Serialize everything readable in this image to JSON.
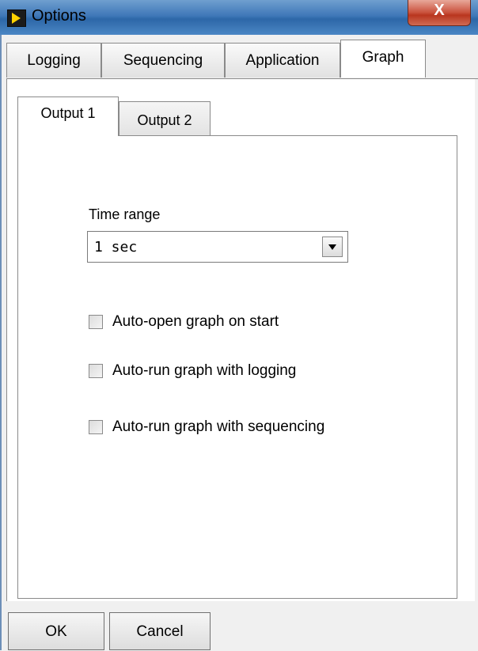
{
  "window": {
    "title": "Options",
    "close_label": "X"
  },
  "top_tabs": [
    {
      "label": "Logging"
    },
    {
      "label": "Sequencing"
    },
    {
      "label": "Application"
    },
    {
      "label": "Graph"
    }
  ],
  "inner_tabs": [
    {
      "label": "Output 1"
    },
    {
      "label": "Output 2"
    }
  ],
  "graph": {
    "time_range_label": "Time range",
    "time_range_value": "1 sec",
    "checkboxes": [
      {
        "label": "Auto-open graph on start",
        "checked": false
      },
      {
        "label": "Auto-run graph with logging",
        "checked": false
      },
      {
        "label": "Auto-run graph with sequencing",
        "checked": false
      }
    ]
  },
  "buttons": {
    "ok": "OK",
    "cancel": "Cancel"
  },
  "icons": {
    "app": "labview-icon",
    "close": "close-icon",
    "dropdown": "chevron-down-icon"
  }
}
